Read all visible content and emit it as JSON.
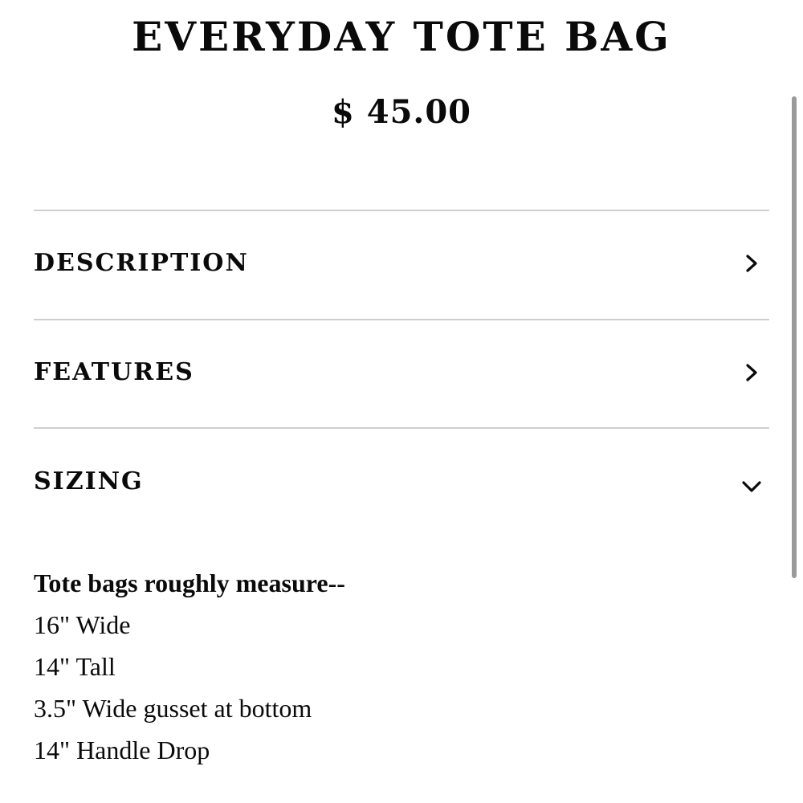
{
  "product": {
    "title": "EVERYDAY TOTE BAG",
    "price": "$ 45.00"
  },
  "accordion": {
    "sections": [
      {
        "label": "DESCRIPTION",
        "icon": "chevron-right-icon",
        "expanded": false
      },
      {
        "label": "FEATURES",
        "icon": "chevron-right-icon",
        "expanded": false
      },
      {
        "label": "SIZING",
        "icon": "chevron-down-icon",
        "expanded": true
      }
    ]
  },
  "sizing": {
    "intro": "Tote bags roughly measure--",
    "lines": [
      "16\" Wide",
      "14\" Tall",
      "3.5\" Wide gusset at bottom",
      "14\" Handle Drop"
    ]
  },
  "colors": {
    "text": "#0a0a0a",
    "divider": "#cfcfcf",
    "scrollbar": "#9a9a9a",
    "background": "#ffffff"
  }
}
